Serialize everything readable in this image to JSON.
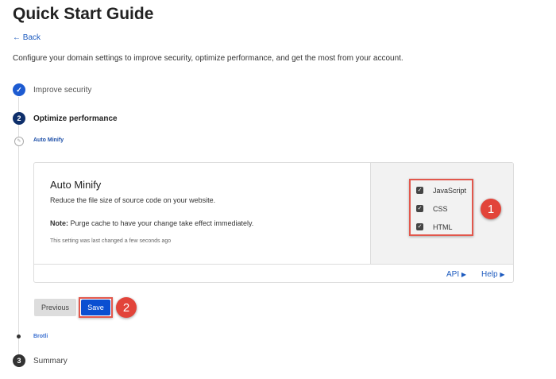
{
  "title": "Quick Start Guide",
  "back": "Back",
  "description": "Configure your domain settings to improve security, optimize performance, and get the most from your account.",
  "steps": [
    {
      "number": "✓",
      "label": "Improve security"
    },
    {
      "number": "2",
      "label": "Optimize performance"
    },
    {
      "number": "3",
      "label": "Summary"
    }
  ],
  "substeps": {
    "current": "Auto Minify",
    "next": "Brotli"
  },
  "card": {
    "title": "Auto Minify",
    "subtitle": "Reduce the file size of source code on your website.",
    "note_label": "Note:",
    "note": " Purge cache to have your change take effect immediately.",
    "last_changed": "This setting was last changed a few seconds ago",
    "options": [
      {
        "label": "JavaScript",
        "checked": true
      },
      {
        "label": "CSS",
        "checked": true
      },
      {
        "label": "HTML",
        "checked": true
      }
    ],
    "api": "API",
    "help": "Help"
  },
  "buttons": {
    "previous": "Previous",
    "save": "Save"
  },
  "annotations": [
    "1",
    "2"
  ],
  "colors": {
    "accent": "#0a4fd1",
    "annotation": "#e2443a"
  }
}
